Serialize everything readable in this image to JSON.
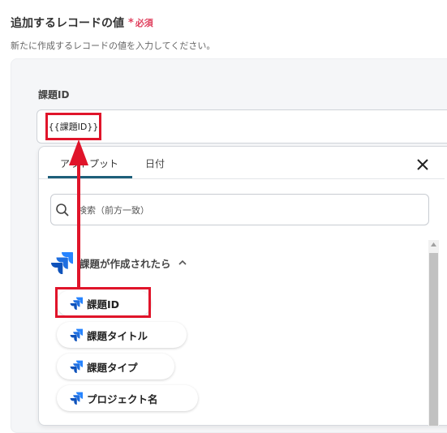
{
  "section": {
    "title": "追加するレコードの値",
    "required_star": "*",
    "required_text": "必須",
    "description": "新たに作成するレコードの値を入力してください。"
  },
  "field": {
    "label": "課題ID",
    "value": "{{課題ID}}"
  },
  "dropdown": {
    "tabs": [
      {
        "label": "アウトプット",
        "active": true
      },
      {
        "label": "日付",
        "active": false
      }
    ],
    "search_placeholder": "検索（前方一致）",
    "group": {
      "title": "課題が作成されたら",
      "expanded": true,
      "icon": "jira-icon",
      "items": [
        {
          "label": "課題ID",
          "icon": "jira-icon",
          "highlighted": true
        },
        {
          "label": "課題タイトル",
          "icon": "jira-icon"
        },
        {
          "label": "課題タイプ",
          "icon": "jira-icon"
        },
        {
          "label": "プロジェクト名",
          "icon": "jira-icon"
        }
      ]
    }
  },
  "colors": {
    "accent": "#1d5f7a",
    "highlight": "#e0142a",
    "required": "#e0405e",
    "jira_blue": "#2684ff"
  }
}
